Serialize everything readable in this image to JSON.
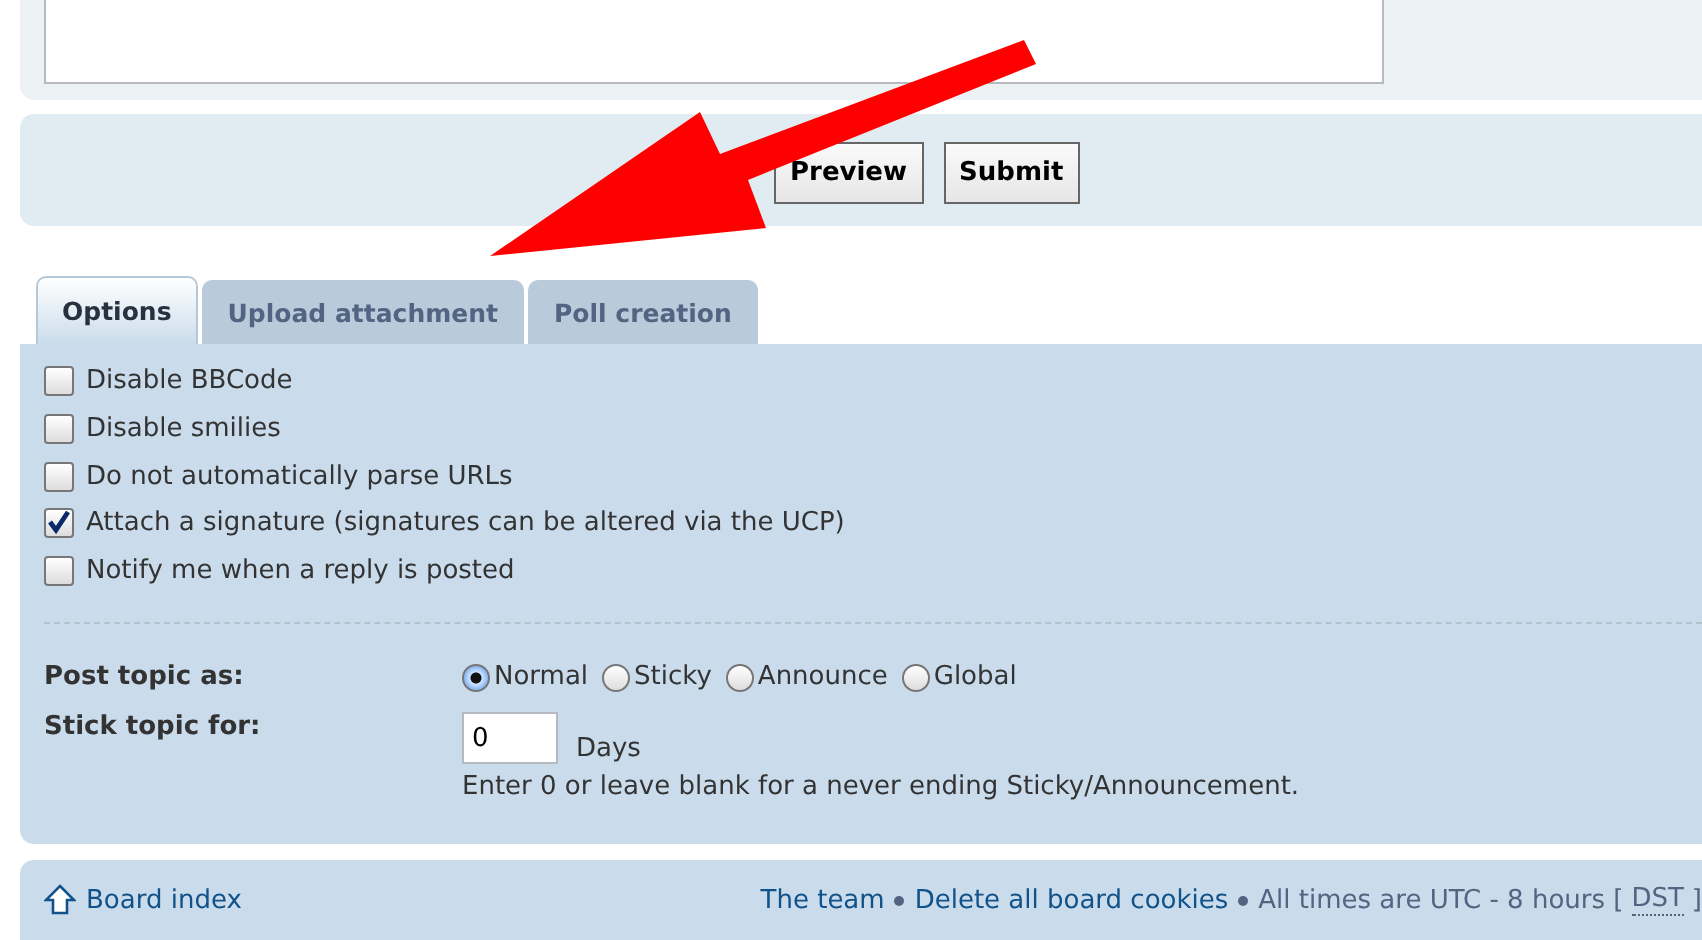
{
  "buttons": [
    {
      "label": "Preview"
    },
    {
      "label": "Submit"
    }
  ],
  "tabs": [
    {
      "label": "Options",
      "selected": true
    },
    {
      "label": "Upload attachment",
      "selected": false
    },
    {
      "label": "Poll creation",
      "selected": false
    }
  ],
  "options": [
    {
      "label": "Disable BBCode",
      "checked": false
    },
    {
      "label": "Disable smilies",
      "checked": false
    },
    {
      "label": "Do not automatically parse URLs",
      "checked": false
    },
    {
      "label": "Attach a signature (signatures can be altered via the UCP)",
      "checked": true
    },
    {
      "label": "Notify me when a reply is posted",
      "checked": false
    }
  ],
  "post_topic": {
    "label": "Post topic as:",
    "choices": [
      {
        "label": "Normal",
        "selected": true
      },
      {
        "label": "Sticky",
        "selected": false
      },
      {
        "label": "Announce",
        "selected": false
      },
      {
        "label": "Global",
        "selected": false
      }
    ]
  },
  "stick_topic": {
    "label": "Stick topic for:",
    "value": "0",
    "unit": "Days",
    "hint": "Enter 0 or leave blank for a never ending Sticky/Announcement."
  },
  "footer": {
    "board_index": "Board index",
    "links": [
      "The team",
      "Delete all board cookies"
    ],
    "times": "All times are UTC - 8 hours [",
    "dst": "DST",
    "close": "]"
  }
}
